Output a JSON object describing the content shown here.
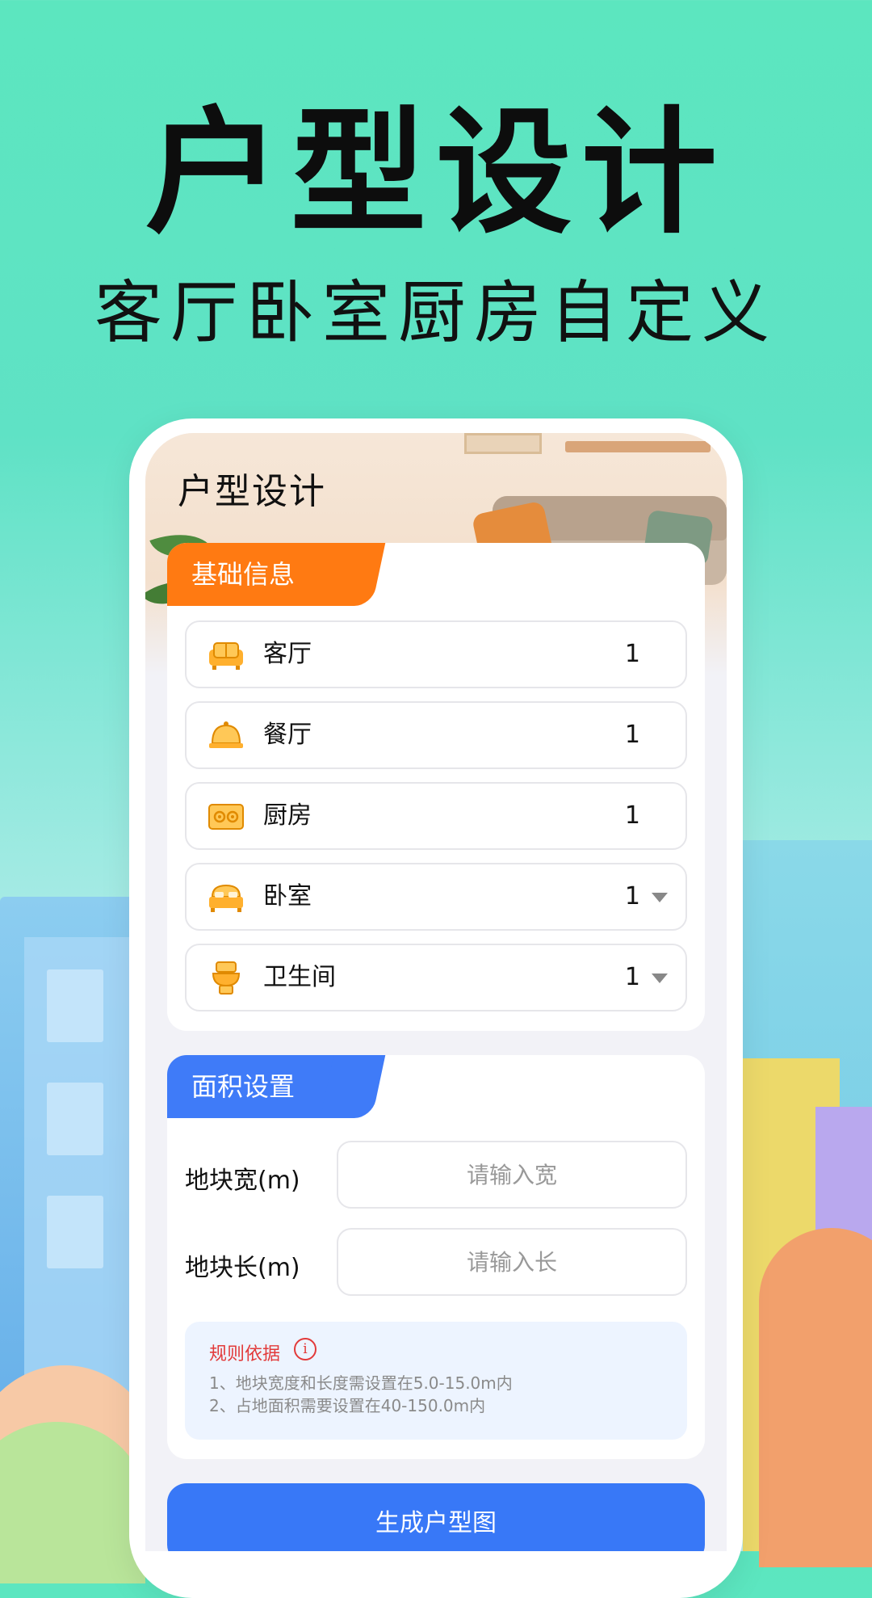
{
  "promo": {
    "title": "户型设计",
    "subtitle": "客厅卧室厨房自定义"
  },
  "app": {
    "title": "户型设计"
  },
  "basic_info": {
    "tab_label": "基础信息",
    "rows": [
      {
        "label": "客厅",
        "value": "1",
        "icon": "sofa-icon",
        "has_dropdown": false
      },
      {
        "label": "餐厅",
        "value": "1",
        "icon": "dining-bell-icon",
        "has_dropdown": false
      },
      {
        "label": "厨房",
        "value": "1",
        "icon": "stove-icon",
        "has_dropdown": false
      },
      {
        "label": "卧室",
        "value": "1",
        "icon": "bed-icon",
        "has_dropdown": true
      },
      {
        "label": "卫生间",
        "value": "1",
        "icon": "toilet-icon",
        "has_dropdown": true
      }
    ]
  },
  "area": {
    "tab_label": "面积设置",
    "width_label": "地块宽(m)",
    "width_placeholder": "请输入宽",
    "length_label": "地块长(m)",
    "length_placeholder": "请输入长",
    "rules": {
      "title": "规则依据",
      "lines": [
        "1、地块宽度和长度需设置在5.0-15.0m内",
        "2、占地面积需要设置在40-150.0m内"
      ]
    }
  },
  "generate_button": "生成户型图",
  "colors": {
    "accent_orange": "#ff7a12",
    "accent_blue": "#3f7bf8",
    "background_mint": "#5ce6bf"
  }
}
